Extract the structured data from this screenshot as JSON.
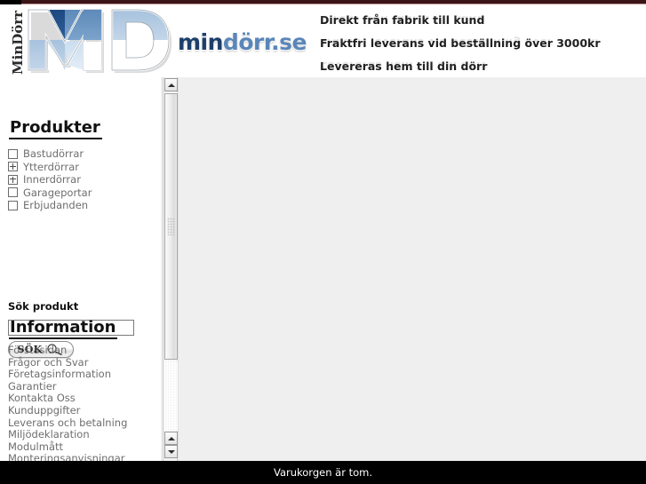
{
  "site": {
    "logo_vertical_text": "MinDörr",
    "wordmark_part1": "min",
    "wordmark_part2": "dörr.se"
  },
  "header": {
    "taglines": [
      "Direkt från fabrik till kund",
      "Fraktfri leverans vid beställning över 3000kr",
      "Levereras hem till din dörr"
    ]
  },
  "sidebar": {
    "products": {
      "heading": "Produkter",
      "items": [
        {
          "label": "Bastudörrar",
          "icon": "empty-box-icon",
          "expandable": false
        },
        {
          "label": "Ytterdörrar",
          "icon": "plus-box-icon",
          "expandable": true
        },
        {
          "label": "Innerdörrar",
          "icon": "plus-box-icon",
          "expandable": true
        },
        {
          "label": "Garageportar",
          "icon": "empty-box-icon",
          "expandable": false
        },
        {
          "label": "Erbjudanden",
          "icon": "empty-box-icon",
          "expandable": false
        }
      ]
    },
    "search": {
      "label": "Sök produkt",
      "value": "",
      "placeholder": "",
      "button_label": "SÖK",
      "button_icon": "magnifier-icon"
    },
    "information": {
      "heading": "Information",
      "items": [
        "Förstasidan",
        "Frågor och Svar",
        "Företagsinformation",
        "Garantier",
        "Kontakta Oss",
        "Kunduppgifter",
        "Leverans och betalning",
        "Miljödeklaration",
        "Modulmått",
        "Monteringsanvisningar"
      ]
    }
  },
  "scrollbar": {
    "up_arrow_icon": "triangle-up-icon",
    "down_arrow_icon": "triangle-down-icon"
  },
  "status_bar": {
    "text": "Varukorgen är tom."
  },
  "colors": {
    "logo_dark_blue": "#1d3f6b",
    "logo_mid_blue": "#5a86b8",
    "logo_light_blue": "#9fbcd9",
    "top_rule": "#3b1518",
    "content_bg": "#efeff0",
    "status_bg": "#000000"
  }
}
